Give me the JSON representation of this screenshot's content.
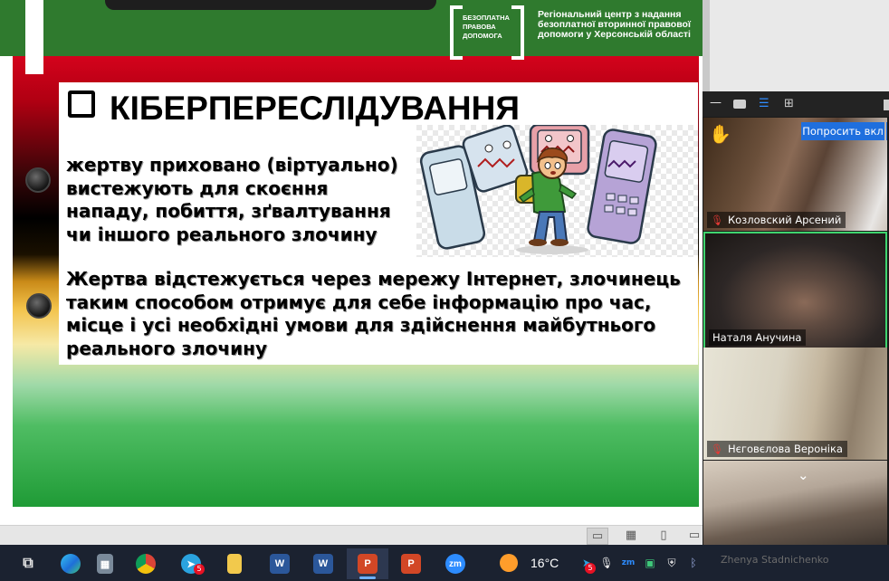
{
  "slide": {
    "logo_text": "БЕЗОПЛАТНА ПРАВОВА ДОПОМОГА",
    "center_name": "Регіональний центр з надання безоплатної вторинної правової допомоги у Херсонській області",
    "title": "КІБЕРПЕРЕСЛІДУВАННЯ",
    "paragraph1": "жертву приховано (віртуально) вистежують для скоєння нападу, побиття, зґвалтування чи іншого реального злочину",
    "paragraph2": "Жертва відстежується через мережу Інтернет, злочинець таким способом отримує для себе інформацію про час, місце і усі необхідні умови для здійснення майбутнього реального злочину"
  },
  "zoom": {
    "spotlight_button": "Попросить вкл",
    "participants": [
      {
        "name": "Козловский Арсений",
        "muted": true
      },
      {
        "name": "Наталя Анучина",
        "muted": false,
        "active_speaker": true
      },
      {
        "name": "Нєговєлова Вероніка",
        "muted": true
      },
      {
        "name": "Zhenya Stadnichenko",
        "muted": true
      }
    ],
    "icons": [
      "minimize-icon",
      "speaker-view-icon",
      "strip-view-icon",
      "gallery-view-icon",
      "raise-hand-icon",
      "chevron-down-icon"
    ]
  },
  "taskbar": {
    "weather_temp": "16°C",
    "telegram_badge": "5",
    "tray_badge": "5",
    "apps": [
      "task-view",
      "edge",
      "calculator",
      "chrome",
      "telegram",
      "file-explorer",
      "word",
      "word",
      "powerpoint",
      "powerpoint",
      "zoom"
    ],
    "zoom_label": "zm"
  },
  "colors": {
    "header_green": "#2f7a2e",
    "active_speaker_border": "#3fd46e",
    "spotlight_blue": "#1f6fde",
    "taskbar_bg": "#1b2230"
  }
}
